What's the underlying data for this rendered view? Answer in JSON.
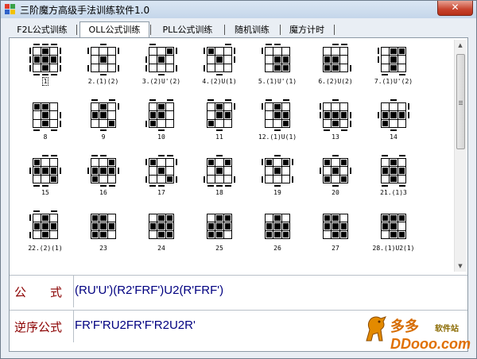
{
  "window": {
    "title": "三阶魔方高级手法训练软件1.0",
    "close_glyph": "✕"
  },
  "tabs": [
    {
      "label": "F2L公式训练",
      "active": false
    },
    {
      "label": "OLL公式训练",
      "active": true
    },
    {
      "label": "PLL公式训练",
      "active": false
    },
    {
      "label": "随机训练",
      "active": false
    },
    {
      "label": "魔方计时",
      "active": false
    }
  ],
  "cases": [
    {
      "label": "1",
      "pattern": "010111010",
      "top": "111",
      "bottom": "111",
      "left": "111",
      "right": "111",
      "selected": true
    },
    {
      "label": "2.(1)(2)",
      "pattern": "000010000",
      "top": "010",
      "bottom": "010",
      "left": "101",
      "right": "101"
    },
    {
      "label": "3.(2)U'(2)",
      "pattern": "001010000",
      "top": "100",
      "bottom": "010",
      "left": "011",
      "right": "101"
    },
    {
      "label": "4.(2)U(1)",
      "pattern": "100010000",
      "top": "001",
      "bottom": "010",
      "left": "101",
      "right": "110"
    },
    {
      "label": "5.(1)U'(1)",
      "pattern": "000011011",
      "top": "110",
      "bottom": "000",
      "left": "100",
      "right": "000"
    },
    {
      "label": "6.(2)U(2)",
      "pattern": "000110110",
      "top": "011",
      "bottom": "000",
      "left": "000",
      "right": "001"
    },
    {
      "label": "7.(1)U'(2)",
      "pattern": "011010010",
      "top": "000",
      "bottom": "101",
      "left": "110",
      "right": "000"
    },
    {
      "label": "8",
      "pattern": "110010010",
      "top": "000",
      "bottom": "101",
      "left": "000",
      "right": "011"
    },
    {
      "label": "9",
      "pattern": "010110001",
      "top": "101",
      "bottom": "010",
      "left": "000",
      "right": "100"
    },
    {
      "label": "10",
      "pattern": "010110100",
      "top": "101",
      "bottom": "010",
      "left": "001",
      "right": "000"
    },
    {
      "label": "11",
      "pattern": "010011100",
      "top": "101",
      "bottom": "010",
      "left": "000",
      "right": "100"
    },
    {
      "label": "12.(1)U(1)",
      "pattern": "010011001",
      "top": "101",
      "bottom": "010",
      "left": "100",
      "right": "000"
    },
    {
      "label": "13",
      "pattern": "000111010",
      "top": "010",
      "bottom": "101",
      "left": "110",
      "right": "011"
    },
    {
      "label": "14",
      "pattern": "000111100",
      "top": "010",
      "bottom": "010",
      "left": "010",
      "right": "110"
    },
    {
      "label": "15",
      "pattern": "100111001",
      "top": "011",
      "bottom": "110",
      "left": "010",
      "right": "010"
    },
    {
      "label": "16",
      "pattern": "001111100",
      "top": "110",
      "bottom": "011",
      "left": "010",
      "right": "010"
    },
    {
      "label": "17",
      "pattern": "100010001",
      "top": "011",
      "bottom": "110",
      "left": "101",
      "right": "101"
    },
    {
      "label": "18",
      "pattern": "101010000",
      "top": "010",
      "bottom": "111",
      "left": "001",
      "right": "001"
    },
    {
      "label": "19",
      "pattern": "101010000",
      "top": "010",
      "bottom": "010",
      "left": "101",
      "right": "101"
    },
    {
      "label": "20",
      "pattern": "101010101",
      "top": "010",
      "bottom": "010",
      "left": "010",
      "right": "010"
    },
    {
      "label": "21.(1)3",
      "pattern": "010111010",
      "top": "101",
      "bottom": "101",
      "left": "000",
      "right": "000"
    },
    {
      "label": "22.(2)(1)",
      "pattern": "010111010",
      "top": "101",
      "bottom": "000",
      "left": "101",
      "right": "000"
    },
    {
      "label": "23",
      "pattern": "110111110",
      "top": "000",
      "bottom": "000",
      "left": "000",
      "right": "000"
    },
    {
      "label": "24",
      "pattern": "011111011",
      "top": "000",
      "bottom": "000",
      "left": "000",
      "right": "000"
    },
    {
      "label": "25",
      "pattern": "011111110",
      "top": "000",
      "bottom": "000",
      "left": "000",
      "right": "000"
    },
    {
      "label": "26",
      "pattern": "010111111",
      "top": "000",
      "bottom": "000",
      "left": "000",
      "right": "000"
    },
    {
      "label": "27",
      "pattern": "110111011",
      "top": "000",
      "bottom": "000",
      "left": "000",
      "right": "000"
    },
    {
      "label": "28.(1)U2(1)",
      "pattern": "111110011",
      "top": "000",
      "bottom": "000",
      "left": "000",
      "right": "000"
    }
  ],
  "formula": {
    "label": "公　　式",
    "value": "(RU'U')(R2'FRF')U2(R'FRF')"
  },
  "reverse": {
    "label": "逆序公式",
    "value": "FR'F'RU2FR'F'R2U2R'"
  },
  "watermark": {
    "brand": "多多",
    "suffix": "软件站",
    "domain": "DDooo.com"
  },
  "colors": {
    "sticker": "#000000",
    "formula_label": "#8b0000",
    "formula_value": "#000080"
  }
}
